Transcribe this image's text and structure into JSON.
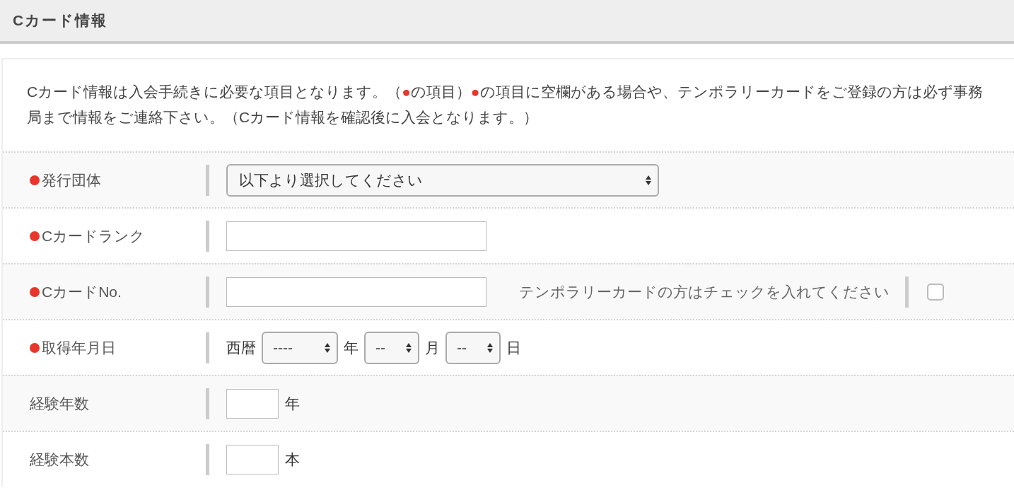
{
  "section": {
    "title": "Cカード情報"
  },
  "intro": [
    {
      "kind": "text",
      "text": "Cカード情報は入会手続きに必要な項目となります。（"
    },
    {
      "kind": "mark",
      "text": "●"
    },
    {
      "kind": "text",
      "text": "の項目）"
    },
    {
      "kind": "mark",
      "text": "●"
    },
    {
      "kind": "text",
      "text": "の項目に空欄がある場合や、テンポラリーカードをご登録の方は必ず事務局まで情報をご連絡下さい。（Cカード情報を確認後に入会となります。）"
    }
  ],
  "rows": [
    {
      "kind": "select",
      "label": "発行団体",
      "required": true,
      "value": "以下より選択してください"
    },
    {
      "kind": "text",
      "label": "Cカードランク",
      "required": true
    },
    {
      "kind": "text_with_checkbox",
      "label": "CカードNo.",
      "required": true,
      "note": "テンポラリーカードの方はチェックを入れてください",
      "checked": false
    },
    {
      "kind": "date",
      "label": "取得年月日",
      "required": true,
      "era": "西暦",
      "parts": [
        {
          "value": "----",
          "unit": "年"
        },
        {
          "value": "--",
          "unit": "月"
        },
        {
          "value": "--",
          "unit": "日"
        }
      ]
    },
    {
      "kind": "number",
      "label": "経験年数",
      "required": false,
      "unit": "年"
    },
    {
      "kind": "number",
      "label": "経験本数",
      "required": false,
      "unit": "本"
    }
  ]
}
